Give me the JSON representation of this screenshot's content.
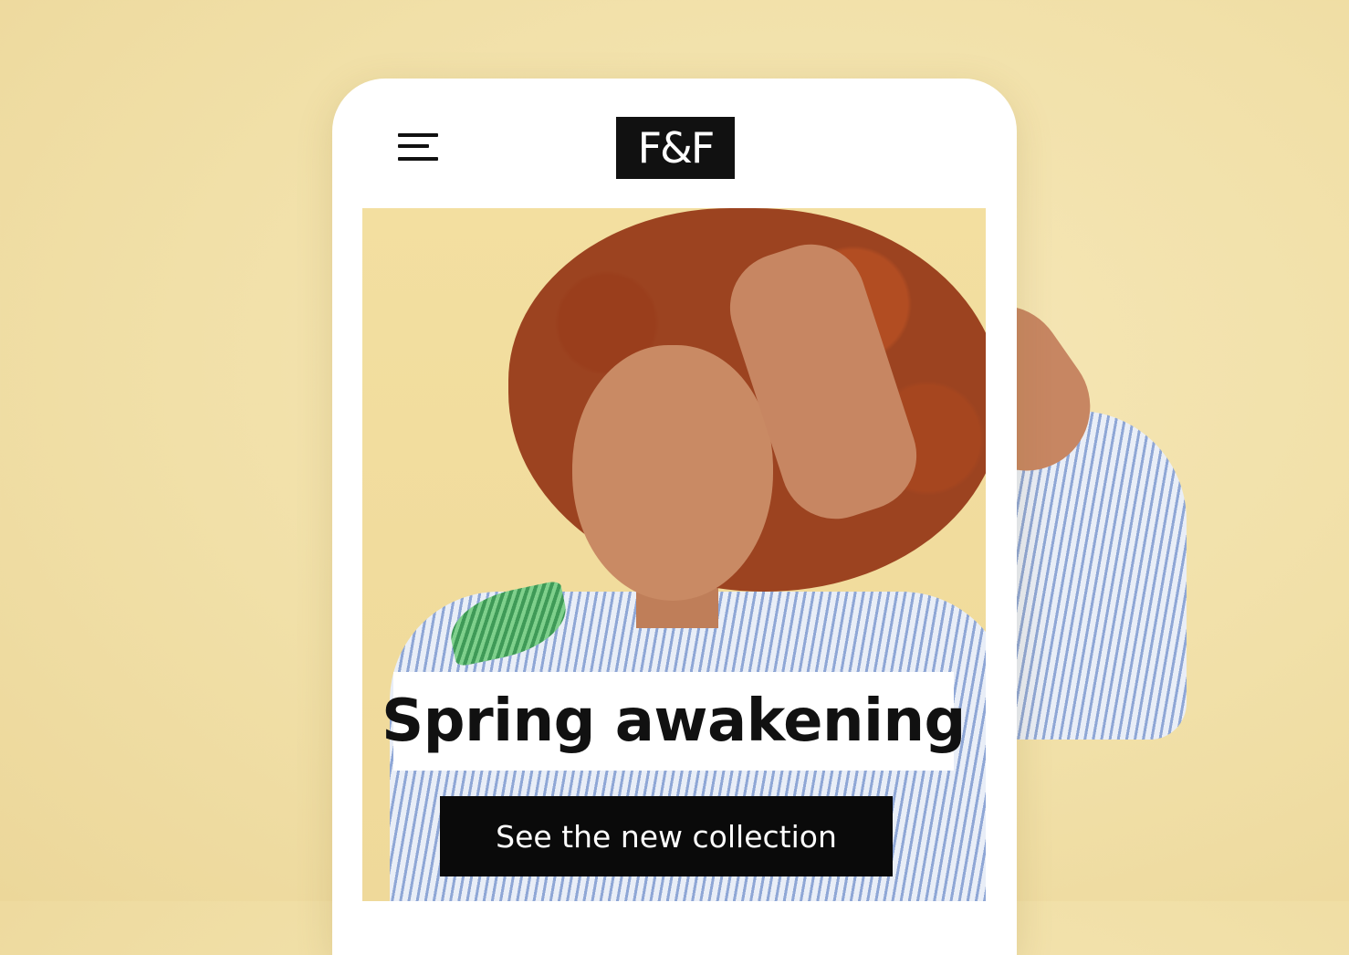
{
  "header": {
    "menu_icon": "hamburger-menu-icon",
    "logo_text": "F&F"
  },
  "hero": {
    "headline": "Spring awakening",
    "cta_label": "See the new collection"
  },
  "colors": {
    "background": "#f3e3ad",
    "phone": "#ffffff",
    "logo_bg": "#111111",
    "cta_bg": "#0a0a0a",
    "cta_text": "#ffffff"
  }
}
